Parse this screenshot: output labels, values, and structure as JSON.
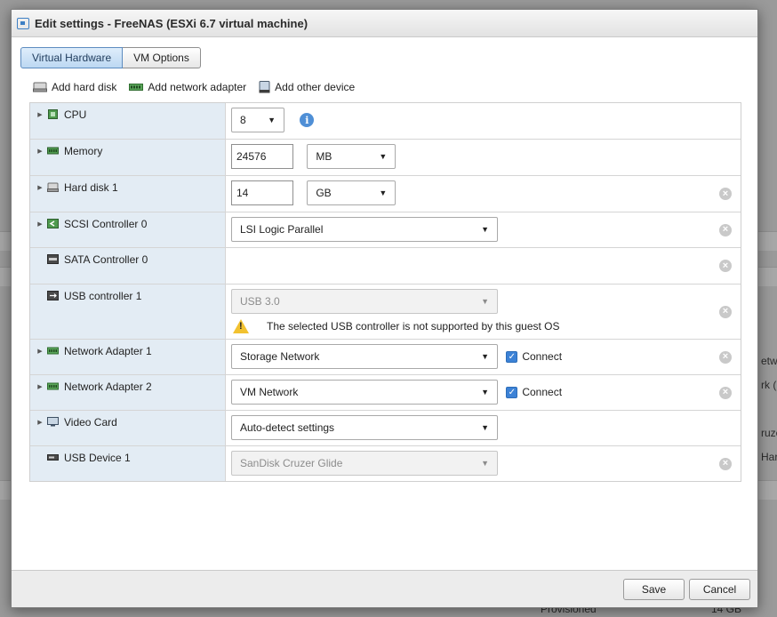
{
  "dialog": {
    "title": "Edit settings - FreeNAS (ESXi 6.7 virtual machine)",
    "tabs": [
      {
        "label": "Virtual Hardware",
        "active": true
      },
      {
        "label": "VM Options",
        "active": false
      }
    ],
    "toolbar": {
      "add_hard_disk": "Add hard disk",
      "add_network_adapter": "Add network adapter",
      "add_other_device": "Add other device"
    },
    "devices": {
      "cpu": {
        "label": "CPU",
        "value": "8"
      },
      "memory": {
        "label": "Memory",
        "value": "24576",
        "unit": "MB"
      },
      "hard_disk": {
        "label": "Hard disk 1",
        "value": "14",
        "unit": "GB"
      },
      "scsi": {
        "label": "SCSI Controller 0",
        "value": "LSI Logic Parallel"
      },
      "sata": {
        "label": "SATA Controller 0"
      },
      "usb_controller": {
        "label": "USB controller 1",
        "value": "USB 3.0",
        "warning": "The selected USB controller is not supported by this guest OS"
      },
      "net1": {
        "label": "Network Adapter 1",
        "value": "Storage Network",
        "connect_label": "Connect",
        "connected": true
      },
      "net2": {
        "label": "Network Adapter 2",
        "value": "VM Network",
        "connect_label": "Connect",
        "connected": true
      },
      "video": {
        "label": "Video Card",
        "value": "Auto-detect settings"
      },
      "usb_device": {
        "label": "USB Device 1",
        "value": "SanDisk Cruzer Glide"
      }
    },
    "footer": {
      "save": "Save",
      "cancel": "Cancel"
    }
  },
  "background": {
    "fragments": [
      "etwo",
      "rk (",
      "ruze",
      "Har",
      "Provisioned",
      "14 GB"
    ]
  },
  "colors": {
    "accent": "#3c82d6",
    "label_column": "#e3ecf4",
    "warning": "#f2c230"
  }
}
